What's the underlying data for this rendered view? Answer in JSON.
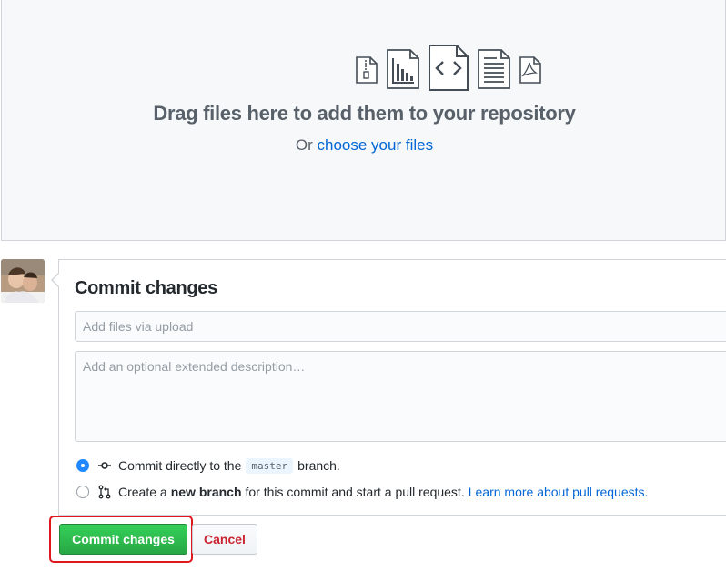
{
  "dropzone": {
    "title": "Drag files here to add them to your repository",
    "sub_prefix": "Or",
    "choose_link": "choose your files",
    "icons": [
      "zip-file-icon",
      "graph-file-icon",
      "code-file-icon",
      "text-file-icon",
      "pdf-file-icon"
    ]
  },
  "commit": {
    "title": "Commit changes",
    "summary_placeholder": "Add files via upload",
    "description_placeholder": "Add an optional extended description…",
    "options": [
      {
        "checked": true,
        "icon": "git-commit-icon",
        "text_before": "Commit directly to the",
        "branch": "master",
        "text_after": "branch."
      },
      {
        "checked": false,
        "icon": "git-pull-request-icon",
        "text_before": "Create a",
        "bold": "new branch",
        "text_after": "for this commit and start a pull request.",
        "link": "Learn more about pull requests."
      }
    ],
    "commit_button": "Commit changes",
    "cancel_button": "Cancel"
  },
  "colors": {
    "accent": "#0366d6",
    "commit_green": "#28a745",
    "cancel_red": "#cb2431",
    "highlight": "#e0171c"
  }
}
